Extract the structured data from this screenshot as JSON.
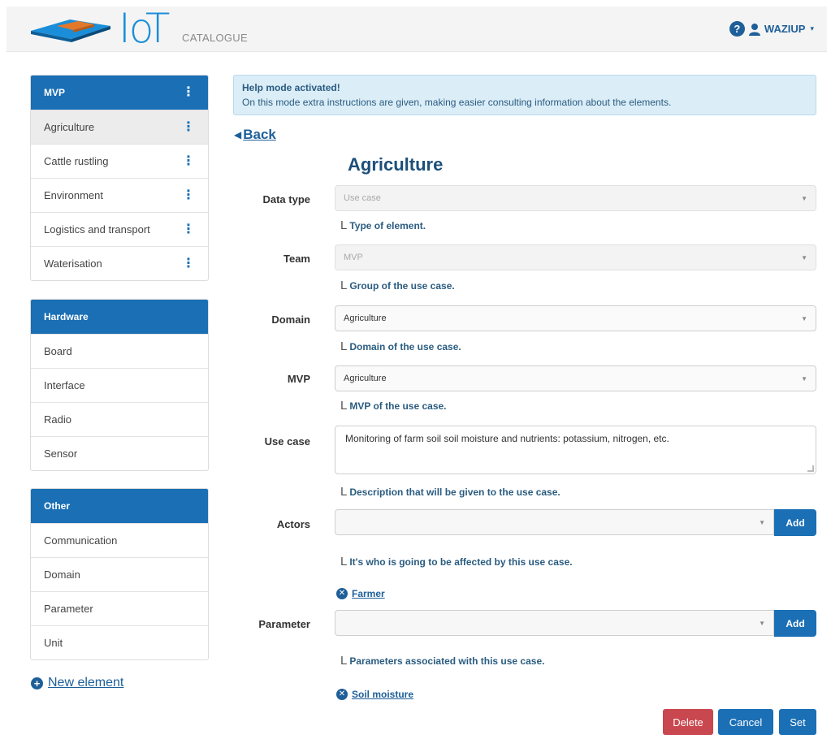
{
  "header": {
    "logo_main": "IoT",
    "logo_sub": "CATALOGUE",
    "username": "WAZIUP",
    "help_glyph": "?",
    "help_icon": "question-circle-icon",
    "user_icon": "user-icon",
    "caret_glyph": "▾"
  },
  "sidebar": {
    "sections": [
      {
        "title": "MVP",
        "items": [
          {
            "label": "Agriculture"
          },
          {
            "label": "Cattle rustling"
          },
          {
            "label": "Environment"
          },
          {
            "label": "Logistics and transport"
          },
          {
            "label": "Waterisation"
          }
        ]
      },
      {
        "title": "Hardware",
        "items": [
          {
            "label": "Board"
          },
          {
            "label": "Interface"
          },
          {
            "label": "Radio"
          },
          {
            "label": "Sensor"
          }
        ]
      },
      {
        "title": "Other",
        "items": [
          {
            "label": "Communication"
          },
          {
            "label": "Domain"
          },
          {
            "label": "Parameter"
          },
          {
            "label": "Unit"
          }
        ]
      }
    ],
    "kebab_glyph": "⋮",
    "new_element_label": "New element",
    "plus_glyph": "+"
  },
  "alert": {
    "title": "Help mode activated!",
    "text": "On this mode extra instructions are given, making easier consulting information about the elements."
  },
  "back_label": "Back",
  "back_glyph": "◀",
  "page_title": "Agriculture",
  "form": {
    "data_type": {
      "label": "Data type",
      "value": "Use case",
      "hint": "Type of element."
    },
    "team": {
      "label": "Team",
      "value": "MVP",
      "hint": "Group of the use case."
    },
    "domain": {
      "label": "Domain",
      "value": "Agriculture",
      "hint": "Domain of the use case."
    },
    "mvp": {
      "label": "MVP",
      "value": "Agriculture",
      "hint": "MVP of the use case."
    },
    "use_case": {
      "label": "Use case",
      "value": "Monitoring of farm soil soil moisture and nutrients: potassium, nitrogen, etc.",
      "hint": "Description that will be given to the use case."
    },
    "actors": {
      "label": "Actors",
      "value": "",
      "hint": "It's who is going to be affected by this use case.",
      "add_label": "Add",
      "tags": [
        "Farmer"
      ]
    },
    "parameter": {
      "label": "Parameter",
      "value": "",
      "hint": "Parameters associated with this use case.",
      "add_label": "Add",
      "tags": [
        "Soil moisture"
      ]
    },
    "select_arrow": "▼",
    "hint_corner": "L",
    "remove_glyph": "✕"
  },
  "actions": {
    "delete_label": "Delete",
    "cancel_label": "Cancel",
    "set_label": "Set"
  },
  "colors": {
    "primary": "#1a6fb5",
    "danger": "#c9474f",
    "alert_bg": "#dbedf7"
  }
}
